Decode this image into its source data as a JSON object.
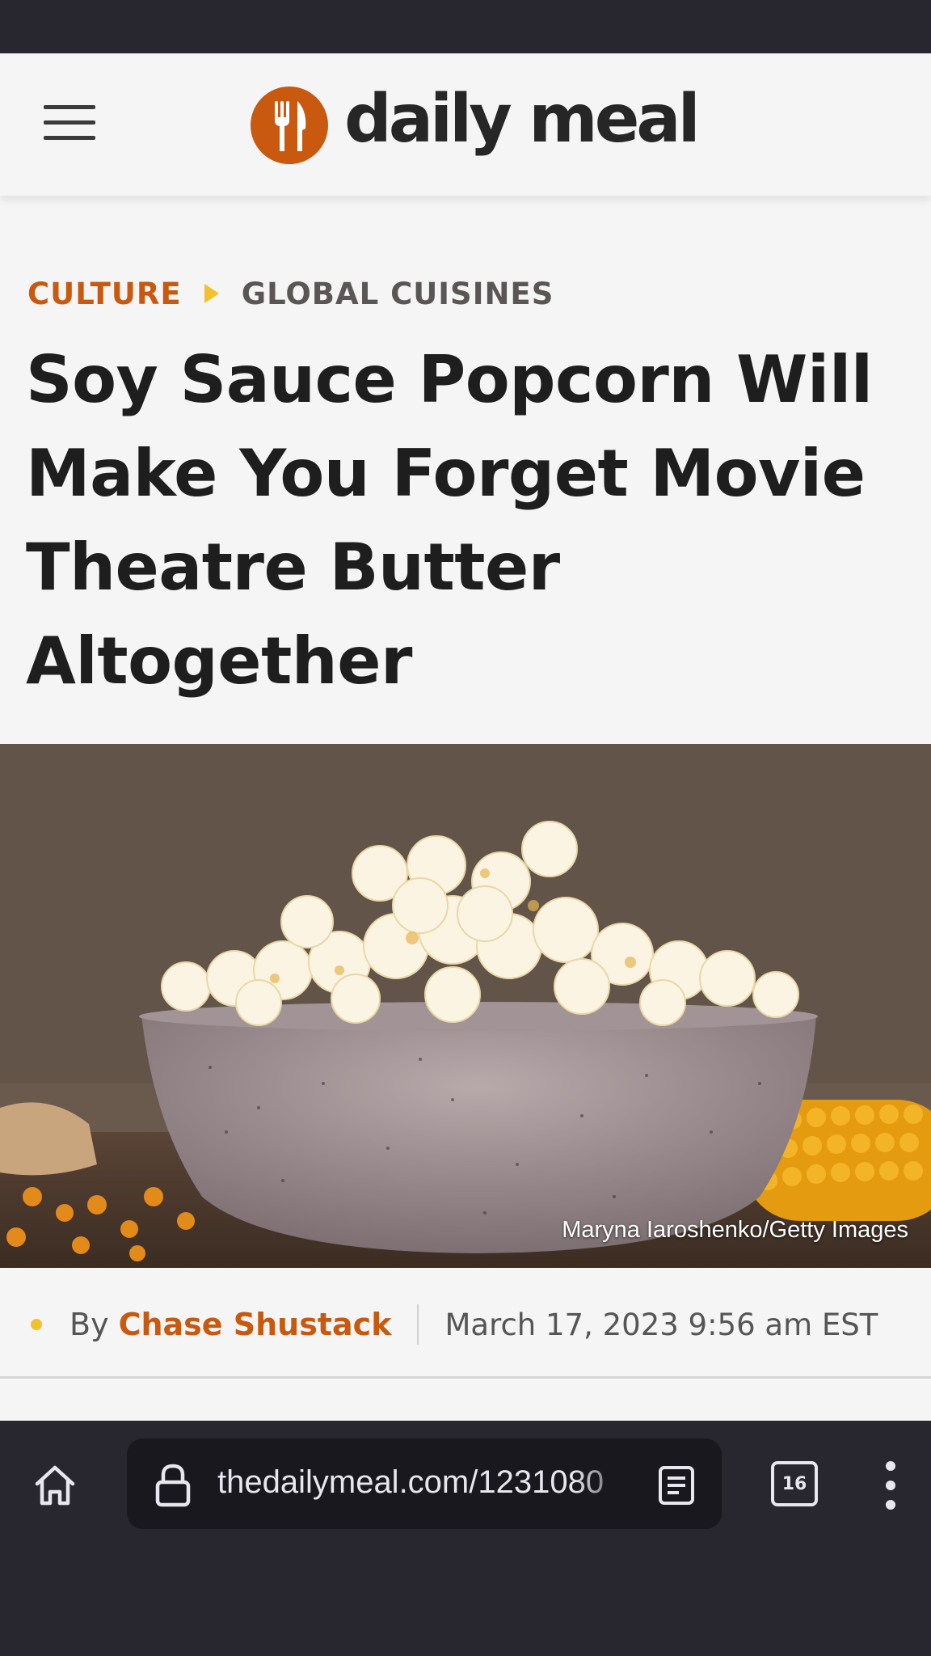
{
  "site": {
    "logo_text": "daily meal",
    "colors": {
      "brand": "#c8590e",
      "accent": "#f2c12e",
      "text": "#1e1e1e"
    }
  },
  "breadcrumb": {
    "category": "CULTURE",
    "subcategory": "GLOBAL CUISINES"
  },
  "article": {
    "headline": "Soy Sauce Popcorn Will Make You Forget Movie Theatre Butter Altogether",
    "image_credit": "Maryna Iaroshenko/Getty Images",
    "byline_prefix": "By",
    "author": "Chase Shustack",
    "date": "March 17, 2023 9:56 am EST"
  },
  "browser": {
    "url": "thedailymeal.com/1231080",
    "tab_count": "16",
    "icons": [
      "home-icon",
      "lock-icon",
      "reader-mode-icon",
      "tabs-icon",
      "overflow-menu-icon"
    ]
  }
}
